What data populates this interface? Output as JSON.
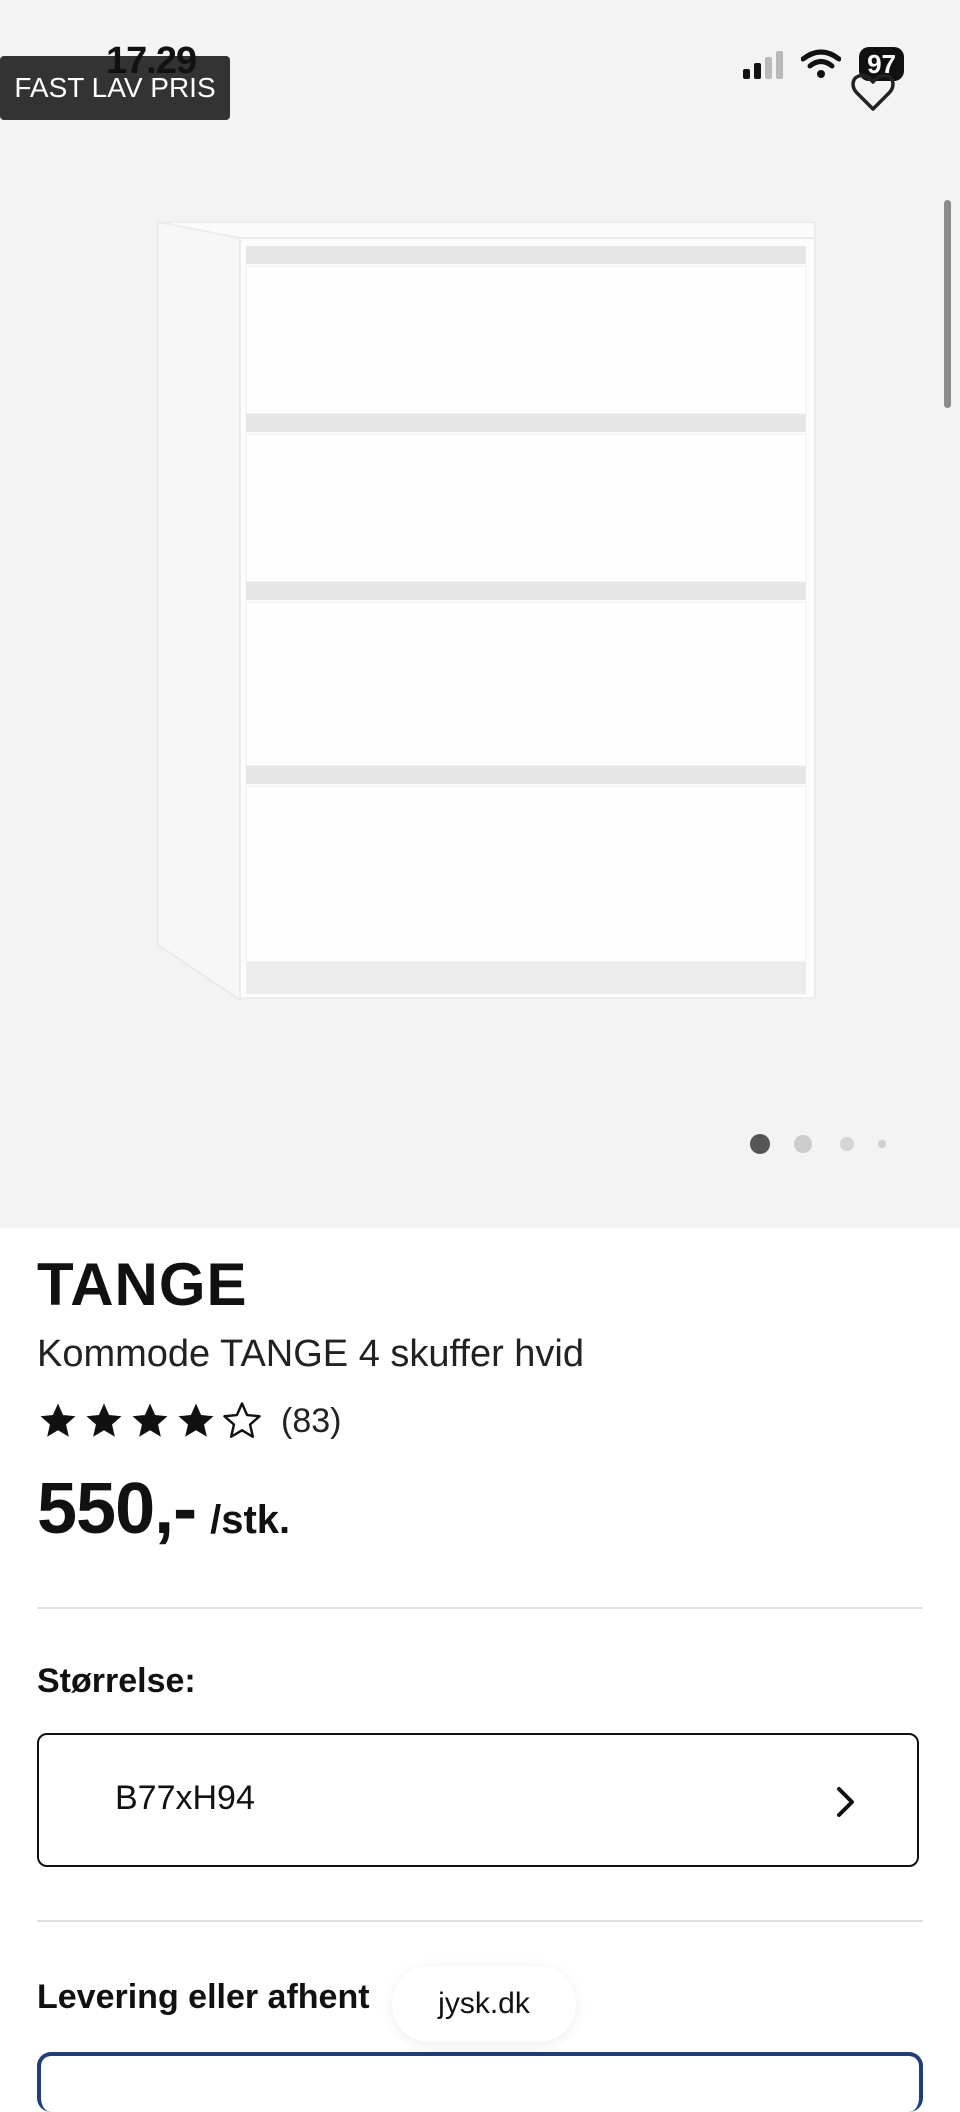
{
  "status_bar": {
    "time": "17.29",
    "battery": "97"
  },
  "badge": {
    "label": "FAST LAV PRIS"
  },
  "carousel": {
    "total": 4,
    "active": 1
  },
  "product": {
    "brand": "TANGE",
    "subtitle": "Kommode TANGE 4 skuffer hvid",
    "rating": {
      "stars": 4,
      "max": 5,
      "count_label": "(83)"
    },
    "price": "550,-",
    "price_unit": "/stk."
  },
  "size": {
    "label": "Størrelse:",
    "value": "B77xH94"
  },
  "delivery": {
    "label": "Levering eller afhent"
  },
  "browser": {
    "url": "jysk.dk"
  },
  "icons": [
    "signal-icon",
    "wifi-icon",
    "battery-icon",
    "heart-icon",
    "star-icon",
    "chevron-right-icon"
  ]
}
